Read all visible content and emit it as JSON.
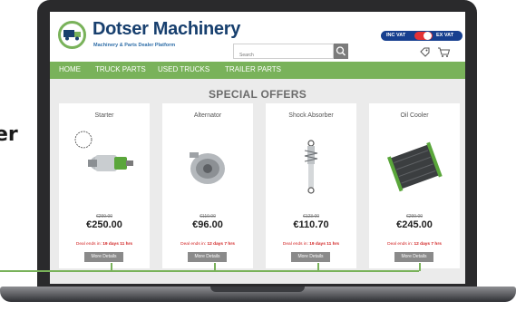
{
  "side_heading": "er",
  "brand": {
    "name": "Dotser Machinery",
    "tagline": "Machinery & Parts Dealer Platform"
  },
  "search": {
    "placeholder": "Search"
  },
  "vat": {
    "inc_label": "INC VAT",
    "ex_label": "EX VAT"
  },
  "nav": [
    "HOME",
    "TRUCK PARTS",
    "USED TRUCKS",
    "TRAILER PARTS"
  ],
  "section_title": "SPECIAL OFFERS",
  "products": [
    {
      "name": "Starter",
      "old_price": "€299.00",
      "price": "€250.00",
      "deal_prefix": "Deal ends in:",
      "deal_time": "19 days 11 hrs",
      "button": "More Details"
    },
    {
      "name": "Alternator",
      "old_price": "€110.00",
      "price": "€96.00",
      "deal_prefix": "Deal ends in:",
      "deal_time": "12 days 7 hrs",
      "button": "More Details"
    },
    {
      "name": "Shock Absorber",
      "old_price": "€123.00",
      "price": "€110.70",
      "deal_prefix": "Deal ends in:",
      "deal_time": "19 days 11 hrs",
      "button": "More Details"
    },
    {
      "name": "Oil Cooler",
      "old_price": "€299.00",
      "price": "€245.00",
      "deal_prefix": "Deal ends in:",
      "deal_time": "12 days 7 hrs",
      "button": "More Details"
    }
  ],
  "colors": {
    "accent_green": "#79b25a",
    "brand_blue": "#173f6e",
    "vat_blue": "#173f8f",
    "deal_red": "#d11f1f"
  }
}
